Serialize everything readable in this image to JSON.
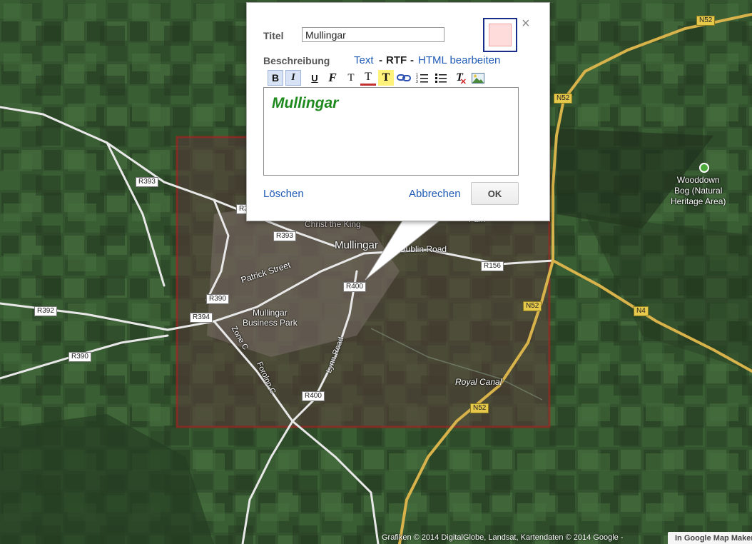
{
  "map": {
    "road_labels": [
      "R393",
      "R393",
      "R3",
      "R390",
      "R392",
      "R390",
      "R394",
      "R400",
      "R400",
      "R156",
      "N52",
      "N52",
      "N52",
      "N52",
      "N4"
    ],
    "places": {
      "christ_the_king": "Christ the King",
      "mullingar": "Mullingar",
      "dublin_road": "Dublin Road",
      "patrick_street": "Patrick Street",
      "business_park": "Mullingar\nBusiness Park",
      "zone_c": "Zone C",
      "forolnn_c": "Forolnn C",
      "lynn_road": "Lynn Road",
      "royal_canal": "Royal Canal",
      "park": "Park",
      "wooddown": "Wooddown\nBog (Natural\nHeritage Area)"
    },
    "overlay_color": "#b02020"
  },
  "infowindow": {
    "title_label": "Titel",
    "title_value": "Mullingar",
    "description_label": "Beschreibung",
    "mode_text": "Text",
    "mode_rtf": "RTF",
    "mode_html": "HTML bearbeiten",
    "mode_sep": "-",
    "editor_text": "Mullingar",
    "delete_label": "Löschen",
    "cancel_label": "Abbrechen",
    "ok_label": "OK",
    "close_glyph": "×",
    "swatch_color": "#ffdcdc",
    "toolbar": {
      "bold": "B",
      "italic": "I",
      "underline": "U",
      "font": "F",
      "size": "T",
      "color": "T",
      "highlight": "T",
      "link": "link",
      "ordered_list": "ordered-list",
      "unordered_list": "unordered-list",
      "clear_format": "T",
      "image": "image"
    }
  },
  "footer": {
    "attribution": "Grafiken © 2014 DigitalGlobe, Landsat, Kartendaten © 2014 Google -",
    "map_maker_link": "In Google Map Maker"
  }
}
